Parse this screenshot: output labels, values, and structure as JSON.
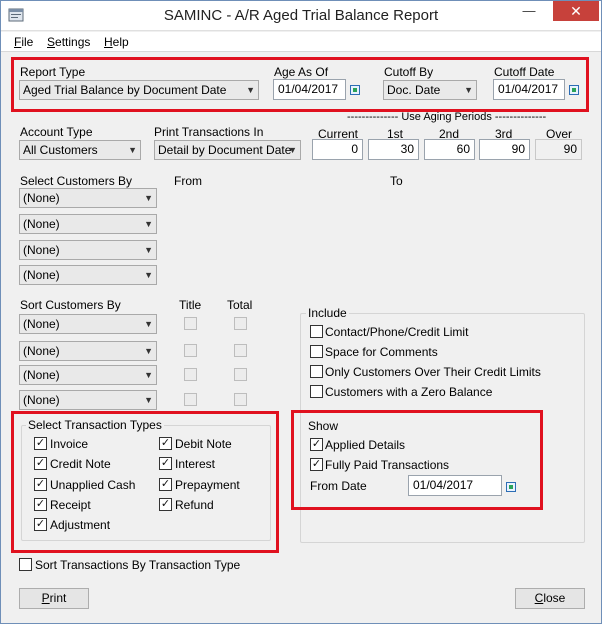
{
  "window": {
    "title": "SAMINC - A/R Aged Trial Balance Report"
  },
  "menu": {
    "file": "File",
    "file_key": "F",
    "file_rest": "ile",
    "settings": "Settings",
    "settings_key": "S",
    "settings_rest": "ettings",
    "help": "Help",
    "help_key": "H",
    "help_rest": "elp"
  },
  "report_type": {
    "label": "Report Type",
    "value": "Aged Trial Balance by Document Date"
  },
  "age_as_of": {
    "label": "Age As Of",
    "value": "01/04/2017"
  },
  "cutoff_by": {
    "label": "Cutoff By",
    "value": "Doc. Date"
  },
  "cutoff_date": {
    "label": "Cutoff Date",
    "value": "01/04/2017"
  },
  "account_type": {
    "label": "Account Type",
    "value": "All Customers"
  },
  "print_transactions_in": {
    "label": "Print Transactions In",
    "value": "Detail by Document Date"
  },
  "aging": {
    "title": "-------------- Use Aging Periods --------------",
    "current_label": "Current",
    "current": "0",
    "first_label": "1st",
    "first": "30",
    "second_label": "2nd",
    "second": "60",
    "third_label": "3rd",
    "third": "90",
    "over_label": "Over",
    "over": "90"
  },
  "select_customers": {
    "label": "Select Customers By",
    "from_label": "From",
    "to_label": "To",
    "rows": [
      "(None)",
      "(None)",
      "(None)",
      "(None)"
    ]
  },
  "sort_customers": {
    "label": "Sort Customers By",
    "title_label": "Title",
    "total_label": "Total",
    "rows": [
      "(None)",
      "(None)",
      "(None)",
      "(None)"
    ]
  },
  "include": {
    "title": "Include",
    "items": [
      "Contact/Phone/Credit Limit",
      "Space for Comments",
      "Only Customers Over Their Credit Limits",
      "Customers with a Zero Balance"
    ]
  },
  "transaction_types": {
    "title": "Select Transaction Types",
    "left": [
      "Invoice",
      "Credit Note",
      "Unapplied Cash",
      "Receipt",
      "Adjustment"
    ],
    "right": [
      "Debit Note",
      "Interest",
      "Prepayment",
      "Refund"
    ]
  },
  "show": {
    "title": "Show",
    "applied_details": "Applied Details",
    "fully_paid": "Fully Paid Transactions",
    "from_date_label": "From Date",
    "from_date": "01/04/2017"
  },
  "sort_by_type": "Sort Transactions By Transaction Type",
  "buttons": {
    "print": "Print",
    "print_key": "P",
    "print_rest": "rint",
    "close": "Close",
    "close_key": "C",
    "close_rest": "lose"
  },
  "colors": {
    "highlight": "#e0111f",
    "window_bg": "#f0f0f0"
  }
}
